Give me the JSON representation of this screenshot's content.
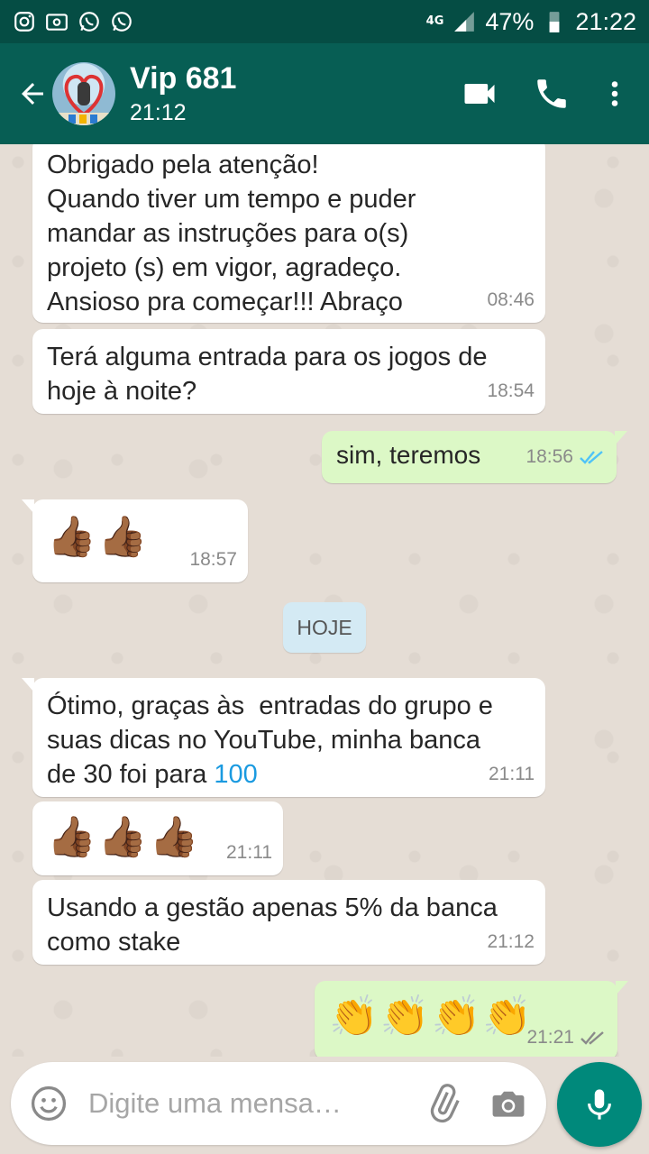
{
  "status_bar": {
    "network": "4G",
    "battery": "47%",
    "time": "21:22"
  },
  "header": {
    "contact_name": "Vip 681",
    "last_seen": "21:12"
  },
  "chat": {
    "date_separator": "HOJE",
    "messages": [
      {
        "direction": "in",
        "text": "Obrigado pela atenção!\nQuando tiver um tempo e puder\nmandar as instruções para o(s)\nprojeto (s) em vigor, agradeço.\nAnsioso pra começar!!! Abraço",
        "time": "08:46"
      },
      {
        "direction": "in",
        "text": "Terá alguma entrada para os jogos de\nhoje à noite?",
        "time": "18:54"
      },
      {
        "direction": "out",
        "text": "sim, teremos",
        "time": "18:56",
        "status": "read"
      },
      {
        "direction": "in",
        "text": "👍🏾👍🏾",
        "time": "18:57"
      },
      {
        "direction": "in",
        "text_before_link": "Ótimo, graças às  entradas do grupo e\nsuas dicas no YouTube, minha banca\nde 30 foi para ",
        "link_text": "100",
        "time": "21:11"
      },
      {
        "direction": "in",
        "text": "👍🏾👍🏾👍🏾",
        "time": "21:11"
      },
      {
        "direction": "in",
        "text": "Usando a gestão apenas 5% da banca\ncomo stake",
        "time": "21:12"
      },
      {
        "direction": "out",
        "text": "👏👏👏👏",
        "time": "21:21",
        "status": "delivered"
      }
    ]
  },
  "composer": {
    "placeholder": "Digite uma mensa…"
  },
  "colors": {
    "header": "#075e54",
    "status_bar": "#054d44",
    "outgoing_bubble": "#dcf8c6",
    "incoming_bubble": "#ffffff",
    "read_ticks": "#4fc3f7",
    "mic_button": "#00897b"
  }
}
